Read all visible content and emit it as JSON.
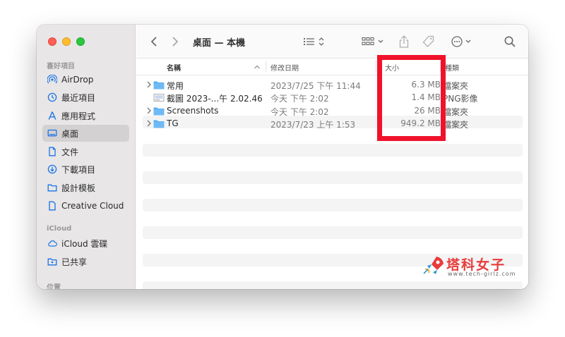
{
  "window": {
    "title": "桌面 — 本機"
  },
  "sidebar": {
    "sections": [
      {
        "label": "喜好項目",
        "items": [
          {
            "label": "AirDrop",
            "icon": "airdrop-icon"
          },
          {
            "label": "最近項目",
            "icon": "clock-icon"
          },
          {
            "label": "應用程式",
            "icon": "apps-icon"
          },
          {
            "label": "桌面",
            "icon": "desktop-icon",
            "active": true
          },
          {
            "label": "文件",
            "icon": "document-icon"
          },
          {
            "label": "下載項目",
            "icon": "download-icon"
          },
          {
            "label": "設計模板",
            "icon": "folder-icon"
          },
          {
            "label": "Creative Cloud",
            "icon": "file-icon"
          }
        ]
      },
      {
        "label": "iCloud",
        "items": [
          {
            "label": "iCloud 雲碟",
            "icon": "cloud-icon"
          },
          {
            "label": "已共享",
            "icon": "shared-folder-icon"
          }
        ]
      },
      {
        "label": "位置",
        "items": []
      }
    ]
  },
  "columns": {
    "name": "名稱",
    "date": "修改日期",
    "size": "大小",
    "kind": "種類"
  },
  "files": [
    {
      "name": "常用",
      "date": "2023/7/25 下午 11:44",
      "size": "6.3 MB",
      "kind": "檔案夾",
      "type": "folder"
    },
    {
      "name": "截圖 2023-...午 2.02.46",
      "date": "今天 下午 2:02",
      "size": "1.4 MB",
      "kind": "PNG影像",
      "type": "image"
    },
    {
      "name": "Screenshots",
      "date": "今天 下午 2:02",
      "size": "26 MB",
      "kind": "檔案夾",
      "type": "folder"
    },
    {
      "name": "TG",
      "date": "2023/7/23 上午 1:53",
      "size": "949.2 MB",
      "kind": "檔案夾",
      "type": "folder"
    }
  ],
  "watermark": {
    "text": "塔科女子",
    "sub": "www.tech-girlz.com"
  },
  "colors": {
    "highlight": "#f0122b",
    "folder": "#5aaef2",
    "accent": "#1a73e8"
  }
}
